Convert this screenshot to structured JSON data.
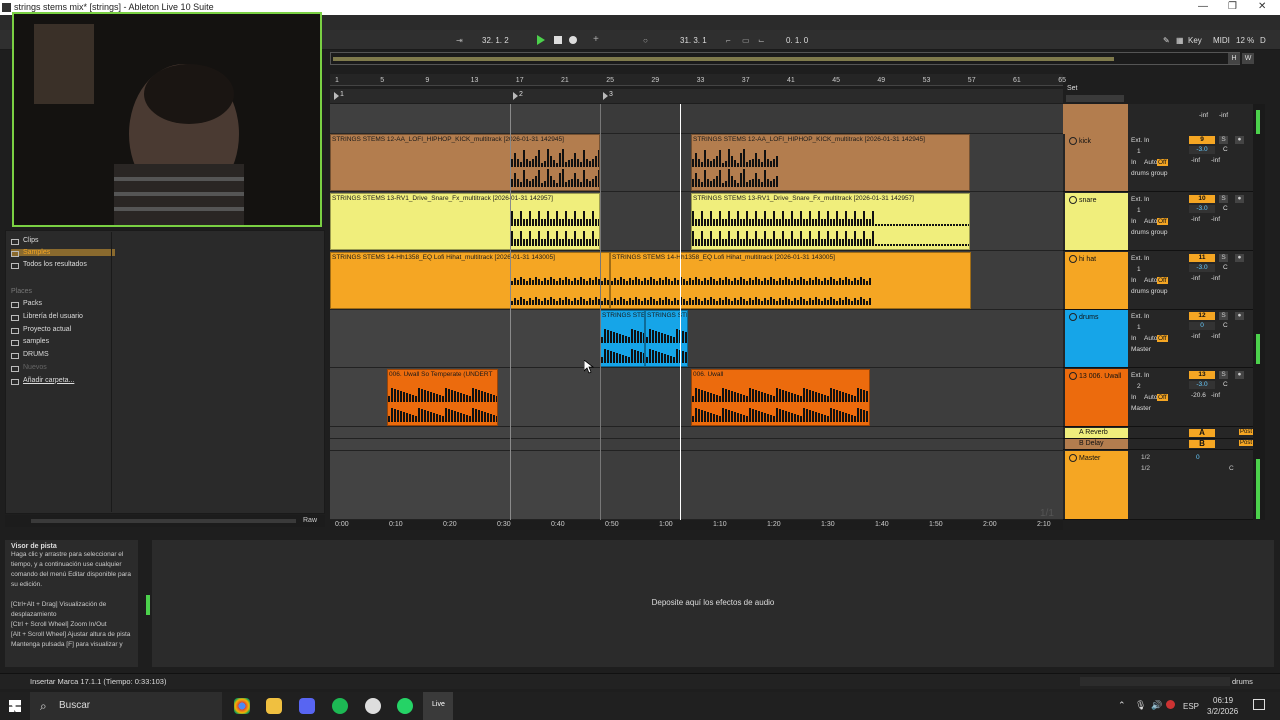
{
  "window": {
    "title": "strings stems mix* [strings] - Ableton Live 10 Suite",
    "controls": [
      "—",
      "❐",
      "✕"
    ]
  },
  "transport": {
    "arrangement_position": "32. 1. 2",
    "loop_start": "31. 3. 1",
    "loop_length": "0. 1. 0",
    "key_label": "Key",
    "midi_label": "MIDI",
    "cpu": "12 %",
    "tempo_letter": "D"
  },
  "overview": {
    "h_button": "H",
    "w_button": "W",
    "scroll_fraction": 0.86
  },
  "ruler": {
    "bars": [
      "1",
      "5",
      "9",
      "13",
      "17",
      "21",
      "25",
      "29",
      "33",
      "37",
      "41",
      "45",
      "49",
      "53",
      "57",
      "61",
      "65"
    ]
  },
  "locators": [
    "1",
    "2",
    "3"
  ],
  "set_label": "Set",
  "time_ruler": [
    "0:00",
    "0:10",
    "0:20",
    "0:30",
    "0:40",
    "0:50",
    "1:00",
    "1:10",
    "1:20",
    "1:30",
    "1:40",
    "1:50",
    "2:00",
    "2:10"
  ],
  "page_indicator": "1/1",
  "tracks": [
    {
      "name": "kick",
      "color": "#b37d4e",
      "input": "Ext. In",
      "channel": "1",
      "monitor": [
        "In",
        "Auto",
        "Off"
      ],
      "output": "drums group",
      "number": "9",
      "volume": "-3.0",
      "pan": "C",
      "sends": [
        "-inf",
        "-inf"
      ],
      "clips": [
        {
          "label": "STRINGS STEMS 12-AA_LOFI_HIPHOP_KICK_multitrack [2026-01-31 142945]"
        },
        {
          "label": "STRINGS STEMS 12-AA_LOFI_HIPHOP_KICK_multitrack [2026-01-31 142945]"
        }
      ]
    },
    {
      "name": "snare",
      "color": "#f0ee7c",
      "input": "Ext. In",
      "channel": "1",
      "monitor": [
        "In",
        "Auto",
        "Off"
      ],
      "output": "drums group",
      "number": "10",
      "volume": "-3.0",
      "pan": "C",
      "sends": [
        "-inf",
        "-inf"
      ],
      "clips": [
        {
          "label": "STRINGS STEMS 13-RV1_Drive_Snare_Fx_multitrack [2026-01-31 142957]"
        },
        {
          "label": "STRINGS STEMS 13-RV1_Drive_Snare_Fx_multitrack [2026-01-31 142957]"
        }
      ]
    },
    {
      "name": "hi hat",
      "color": "#f5a623",
      "input": "Ext. In",
      "channel": "1",
      "monitor": [
        "In",
        "Auto",
        "Off"
      ],
      "output": "drums group",
      "number": "11",
      "volume": "-3.0",
      "pan": "C",
      "sends": [
        "-inf",
        "-inf"
      ],
      "clips": [
        {
          "label": "STRINGS STEMS 14-Hh1358_EQ Lofi Hihat_multitrack [2026-01-31 143005]"
        },
        {
          "label": "STRINGS STEMS 14-Hh1358_EQ Lofi Hihat_multitrack [2026-01-31 143005]"
        }
      ]
    },
    {
      "name": "drums",
      "color": "#16a5e8",
      "input": "Ext. In",
      "channel": "1",
      "monitor": [
        "In",
        "Auto",
        "Off"
      ],
      "output": "Master",
      "number": "12",
      "volume": "0",
      "pan": "C",
      "sends": [
        "-inf",
        "-inf"
      ],
      "clips": [
        {
          "label": "STRINGS STEMS"
        },
        {
          "label": "STRINGS STE"
        }
      ]
    },
    {
      "name": "13 006. Uwall",
      "color": "#ec6b0d",
      "input": "Ext. In",
      "channel": "2",
      "monitor": [
        "In",
        "Auto",
        "Off"
      ],
      "output": "Master",
      "number": "13",
      "volume": "-3.0",
      "pan": "C",
      "sends": [
        "-20.6",
        "-inf"
      ],
      "clips": [
        {
          "label": "006. Uwall So Temperate (UNDERT"
        },
        {
          "label": "006. Uwall"
        }
      ]
    }
  ],
  "top_sends": [
    "-inf",
    "-inf"
  ],
  "returns": [
    {
      "name": "A Reverb",
      "color": "#f0ee7c",
      "letter": "A",
      "post": "Post"
    },
    {
      "name": "B Delay",
      "color": "#b37d4e",
      "letter": "B",
      "post": "Post"
    }
  ],
  "master": {
    "name": "Master",
    "color": "#f5a623",
    "cue": "1/2",
    "out": "1/2",
    "volume": "0",
    "pan": "C"
  },
  "browser": {
    "items": [
      "Clips",
      "Samples",
      "Todos los resultados"
    ],
    "selected": "Samples",
    "places_header": "Places",
    "places": [
      "Packs",
      "Librería del usuario",
      "Proyecto actual",
      "samples",
      "DRUMS",
      "Nuevos",
      "Añadir carpeta..."
    ],
    "raw_label": "Raw"
  },
  "info": {
    "title": "Visor de pista",
    "body": "Haga clic y arrastre para seleccionar el tiempo, y a continuación use cualquier comando del menú Editar disponible para su edición.\n\n[Ctrl+Alt + Drag] Visualización de desplazamiento\n[Ctrl + Scroll Wheel] Zoom In/Out\n[Alt + Scroll Wheel] Ajustar altura de pista\nMantenga pulsada [F] para visualizar y"
  },
  "device_drop": "Deposite aquí los efectos de audio",
  "status": {
    "text": "Insertar Marca 17.1.1 (Tiempo: 0:33:103)",
    "track": "drums"
  },
  "taskbar": {
    "search": "Buscar",
    "live_label": "Live",
    "language": "ESP",
    "time": "06:19",
    "date": "3/2/2026"
  }
}
